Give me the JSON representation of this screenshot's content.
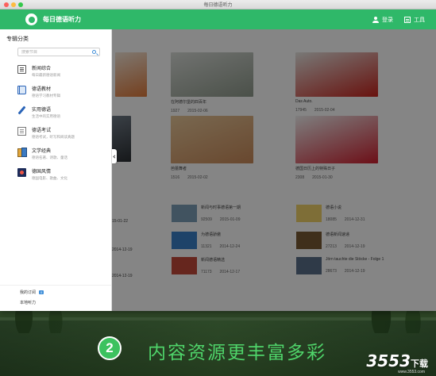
{
  "window": {
    "title": "每日德语听力"
  },
  "topbar": {
    "app_title": "每日德语听力",
    "login_label": "登录",
    "tools_label": "工具"
  },
  "sidebar": {
    "heading": "专辑分类",
    "search_placeholder": "搜索节目",
    "items": [
      {
        "label": "新闻综合",
        "desc": "每日最新德语新闻",
        "icon": "newspaper-icon"
      },
      {
        "label": "德语教材",
        "desc": "德语学习教材专辑",
        "icon": "book-icon"
      },
      {
        "label": "实用德语",
        "desc": "生活中的实用德语",
        "icon": "pencil-icon"
      },
      {
        "label": "德语考试",
        "desc": "德语考试，听写和阅读真题",
        "icon": "exam-doc-icon"
      },
      {
        "label": "文学经典",
        "desc": "德语名著、诗歌、童话",
        "icon": "books-icon"
      },
      {
        "label": "德国风情",
        "desc": "德国电影、歌曲、文化",
        "icon": "film-icon"
      }
    ],
    "subscriptions_label": "我的订阅",
    "subscriptions_badge": "0",
    "local_label": "本地听力"
  },
  "content": {
    "featured": [
      {
        "title": "",
        "plays": "",
        "date": "",
        "color_top": "#f3e6d8",
        "color_bottom": "#e07a3a"
      },
      {
        "title": "在阿德尔堡的四百年",
        "plays": "1927",
        "date": "2015-02-06",
        "color_top": "#d9dcd8",
        "color_bottom": "#8f9a8c"
      },
      {
        "title": "Das Auto.",
        "plays": "17945",
        "date": "2015-02-04",
        "color_top": "#e7e7e3",
        "color_bottom": "#c8231c"
      },
      {
        "title": "",
        "plays": "",
        "date": "",
        "color_top": "#6f7a86",
        "color_bottom": "#2b2f33"
      },
      {
        "title": "芭蕾舞者",
        "plays": "1516",
        "date": "2015-02-02",
        "color_top": "#e8c89a",
        "color_bottom": "#c98a5a"
      },
      {
        "title": "德国日历上的特殊日子",
        "plays": "2308",
        "date": "2015-01-30",
        "color_top": "#f2f2f2",
        "color_bottom": "#d01e2e"
      }
    ],
    "list": [
      {
        "title": "",
        "plays": "",
        "date": "15-01-22",
        "color": "#cdd4c2"
      },
      {
        "title": "新闻与时事德语第一期",
        "plays": "92509",
        "date": "2015-01-09",
        "color": "#7ea0b8"
      },
      {
        "title": "德语小说",
        "plays": "18085",
        "date": "2014-12-31",
        "color": "#f1d36a"
      },
      {
        "title": "",
        "plays": "",
        "date": "2014-12-19",
        "color": "#cdd4c2"
      },
      {
        "title": "为德语骄傲",
        "plays": "11321",
        "date": "2014-12-24",
        "color": "#3a80c9"
      },
      {
        "title": "德语新闻速递",
        "plays": "27213",
        "date": "2014-12-19",
        "color": "#7a5a35"
      },
      {
        "title": "",
        "plays": "",
        "date": "2014-12-19",
        "color": "#cdd4c2"
      },
      {
        "title": "新闻德语精选",
        "plays": "71173",
        "date": "2014-12-17",
        "color": "#c44a3a"
      },
      {
        "title": "Jörn tauchte die Stöcke - Folge 1",
        "plays": "28673",
        "date": "2014-12-19",
        "color": "#5a6f8a"
      }
    ]
  },
  "promo": {
    "step": "2",
    "text": "内容资源更丰富多彩"
  },
  "watermark": {
    "brand": "3553",
    "suffix": "下载",
    "url": "www.3553.com"
  }
}
